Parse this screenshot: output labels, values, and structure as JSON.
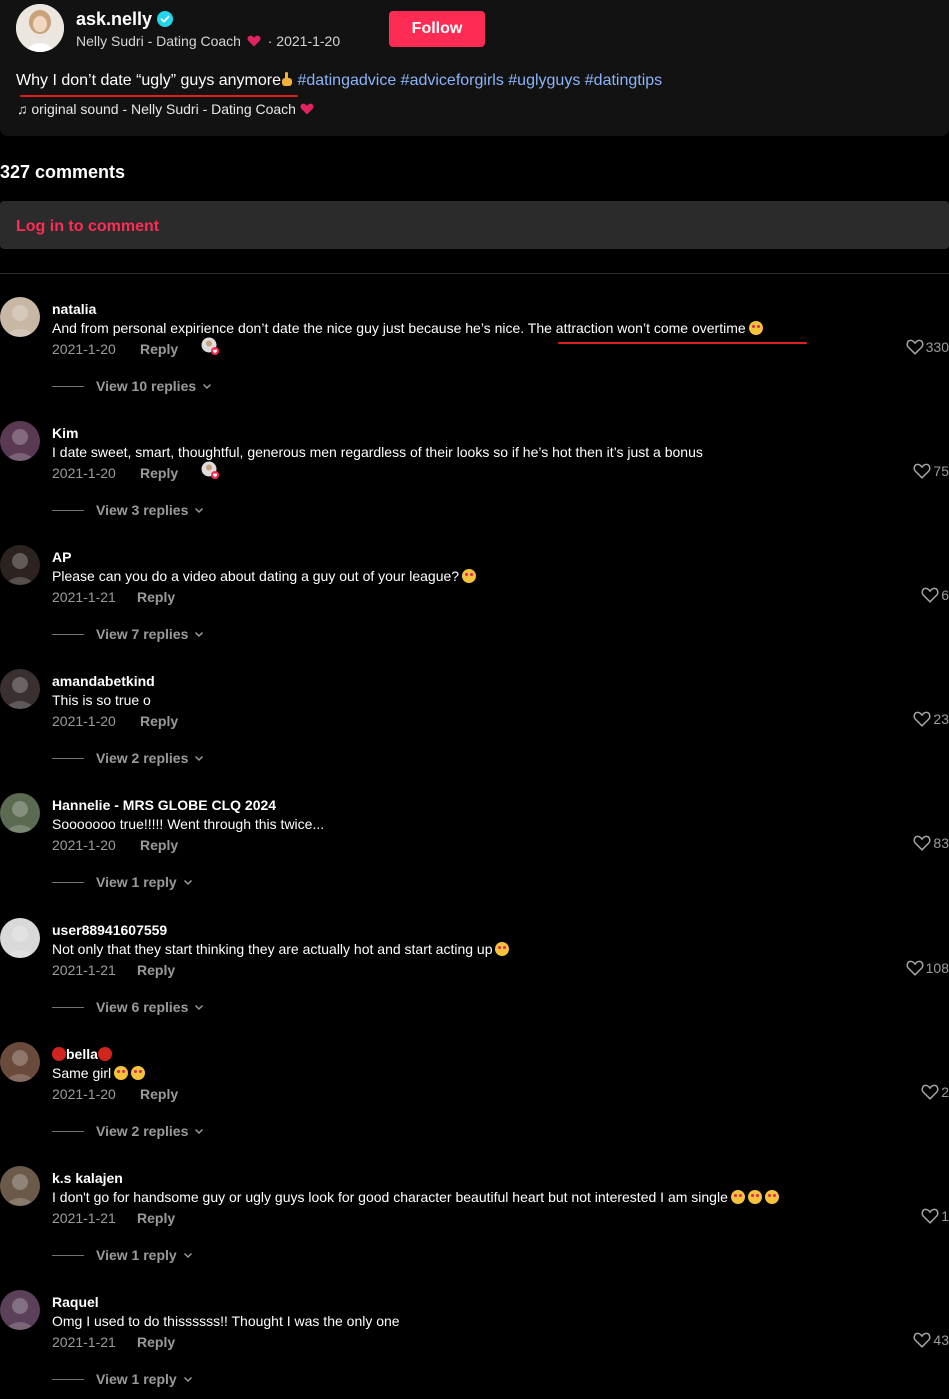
{
  "post": {
    "author_name": "ask.nelly",
    "author_subtitle": "Nelly Sudri - Dating Coach",
    "post_date": "· 2021-1-20",
    "follow_label": "Follow",
    "caption_text": "Why I don’t date “ugly” guys anymore",
    "hashtags": [
      "#datingadvice",
      "#adviceforgirls",
      "#uglyguys",
      "#datingtips"
    ],
    "sound": "original sound - Nelly Sudri - Dating Coach"
  },
  "comments_header": {
    "count_label": "327 comments",
    "login_label": "Log in to comment"
  },
  "reply_label": "Reply",
  "comments": [
    {
      "user": "natalia",
      "text": "And from personal expirience don’t date the nice guy just because he’s nice. The attraction won’t come overtime",
      "date": "2021-1-20",
      "likes": "330",
      "replies": "View 10 replies",
      "avatar_color": "#c9b7a6",
      "creator_liked": true
    },
    {
      "user": "Kim",
      "text": "I date sweet, smart, thoughtful, generous men regardless of their looks so if he’s hot then it’s just a bonus",
      "date": "2021-1-20",
      "likes": "75",
      "replies": "View 3 replies",
      "avatar_color": "#5a3a52",
      "creator_liked": true
    },
    {
      "user": "AP",
      "text": "Please can you do a video about dating a guy out of your league?",
      "date": "2021-1-21",
      "likes": "6",
      "replies": "View 7 replies",
      "avatar_color": "#2c2320",
      "creator_liked": false
    },
    {
      "user": "amandabetkind",
      "text": "This is so true o",
      "date": "2021-1-20",
      "likes": "23",
      "replies": "View 2 replies",
      "avatar_color": "#3a3030",
      "creator_liked": false
    },
    {
      "user": "Hannelie - MRS GLOBE CLQ 2024",
      "text": "Sooooooo true!!!!! Went through this twice...",
      "date": "2021-1-20",
      "likes": "83",
      "replies": "View 1 reply",
      "avatar_color": "#5b6b52",
      "creator_liked": false
    },
    {
      "user": "user88941607559",
      "text": "Not only that they start thinking they are actually hot and start acting up",
      "date": "2021-1-21",
      "likes": "108",
      "replies": "View 6 replies",
      "avatar_color": "#d9d9d9",
      "creator_liked": false
    },
    {
      "user": "bella",
      "text": "Same girl",
      "date": "2021-1-20",
      "likes": "2",
      "replies": "View 2 replies",
      "avatar_color": "#6a4a3a",
      "creator_liked": false
    },
    {
      "user": "k.s kalajen",
      "text": "I don't go for handsome guy or ugly guys look for good character beautiful heart but not interested I am single",
      "date": "2021-1-21",
      "likes": "1",
      "replies": "View 1 reply",
      "avatar_color": "#6b5a4a",
      "creator_liked": false
    },
    {
      "user": "Raquel",
      "text": "Omg I used to do thissssss!! Thought I was the only one",
      "date": "2021-1-21",
      "likes": "43",
      "replies": "View 1 reply",
      "avatar_color": "#5a4058",
      "creator_liked": false
    }
  ]
}
